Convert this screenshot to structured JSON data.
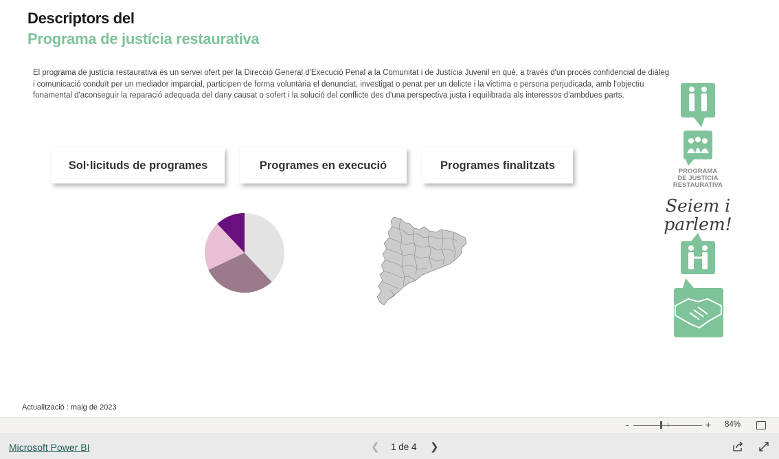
{
  "report": {
    "title_line1": "Descriptors del",
    "title_line2": "Programa de justícia restaurativa",
    "description": "El programa de justícia restaurativa és un servei ofert per la Direcció General d'Execució Penal a la Comunitat i de Justícia Juvenil en què, a través d'un procés confidencial de diàleg i comunicació conduït per un mediador imparcial, participen de forma voluntària el denunciat, investigat o penat per un delicte i la víctima o persona perjudicada, amb l'objectiu fonamental d'aconseguir la reparació adequada del dany causat o sofert i la solució del conflicte des d'una perspectiva justa i equilibrada als interessos d'ambdues parts.",
    "buttons": [
      {
        "label": "Sol·licituds de programes"
      },
      {
        "label": "Programes en execució"
      },
      {
        "label": "Programes finalitzats"
      }
    ],
    "update_text": "Actualització : maig de 2023",
    "logo": {
      "caption_lines": [
        "PROGRAMA",
        "DE JUSTÍCIA",
        "RESTAURATIVA"
      ],
      "slogan_lines": [
        "Seiem i",
        "parlem!"
      ],
      "accent": "#7fc39b"
    }
  },
  "chart_data": {
    "type": "pie",
    "title": "",
    "slices": [
      {
        "value": 38,
        "color": "#e3e3e3"
      },
      {
        "value": 30,
        "color": "#9b7a8c"
      },
      {
        "value": 20,
        "color": "#e9bfd6"
      },
      {
        "value": 12,
        "color": "#6a0f7e"
      }
    ],
    "start_angle_deg": 0
  },
  "map": {
    "region": "Catalunya",
    "fill": "#cccccc"
  },
  "footer": {
    "zoom_minus": "-",
    "zoom_plus": "+",
    "zoom_value": "84%",
    "zoom_level": 0.4,
    "brand_link": "Microsoft Power BI",
    "page_indicator": "1 de 4",
    "icons": [
      "fit-to-page-icon",
      "chevron-left-icon",
      "chevron-right-icon",
      "share-icon",
      "fullscreen-icon"
    ]
  }
}
